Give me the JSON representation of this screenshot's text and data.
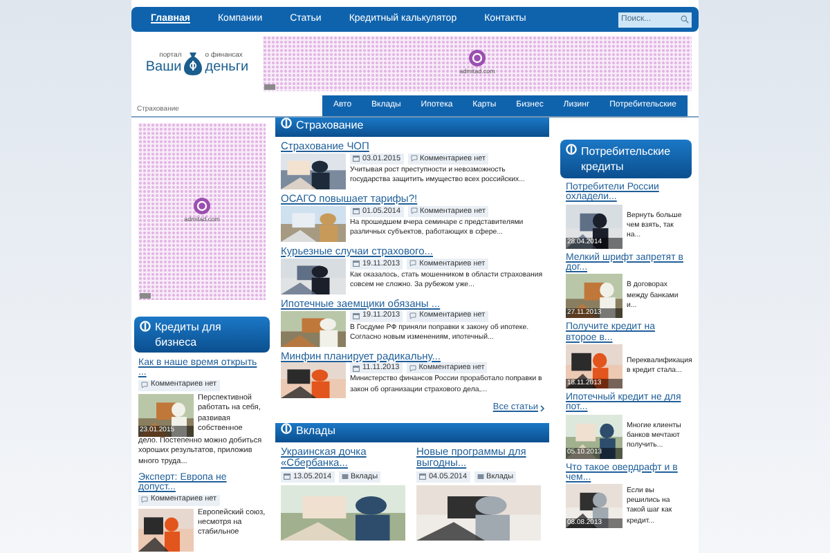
{
  "nav": {
    "items": [
      {
        "label": "Главная",
        "selected": true
      },
      {
        "label": "Компании",
        "selected": false
      },
      {
        "label": "Статьи",
        "selected": false
      },
      {
        "label": "Кредитный калькулятор",
        "selected": false
      },
      {
        "label": "Контакты",
        "selected": false
      }
    ],
    "search": {
      "placeholder": "Поиск..."
    }
  },
  "logo": {
    "top_left": "портал",
    "top_right": "о финансах",
    "left": "Ваши",
    "right": "деньги"
  },
  "banner_ad": {
    "caption": "admitad.com"
  },
  "breadcrumb": "Страхование",
  "subnav": [
    "Авто",
    "Вклады",
    "Ипотека",
    "Карты",
    "Бизнес",
    "Лизинг",
    "Потребительские"
  ],
  "sidebar_ad": {
    "caption": "admitad.com"
  },
  "business": {
    "title": "Кредиты для бизнеса",
    "items": [
      {
        "title": "Как в наше время открыть ...",
        "comments": "Комментариев нет",
        "date": "23.01.2015",
        "excerpt_side": "Перспективной работать на себя, развивая собственное",
        "excerpt_below": "дело. Постепенно можно добиться хороших результатов, приложив много труда..."
      },
      {
        "title": "Эксперт: Европа не допуст...",
        "comments": "Комментариев нет",
        "excerpt_side": "Европейский союз, несмотря на стабильное"
      }
    ]
  },
  "insurance": {
    "title": "Страхование",
    "items": [
      {
        "title": "Страхование ЧОП",
        "date": "03.01.2015",
        "comments": "Комментариев нет",
        "excerpt": "Учитывая рост преступности и невозможность государства защитить имущество всех российских..."
      },
      {
        "title": "ОСАГО повышает тарифы?!",
        "date": "01.05.2014",
        "comments": "Комментариев нет",
        "excerpt": "На прошедшем вчера семинаре с представителями различных субъектов, работающих в сфере..."
      },
      {
        "title": "Курьезные случаи страхового...",
        "date": "19.11.2013",
        "comments": "Комментариев нет",
        "excerpt": "Как оказалось, стать мошенником в области страхования совсем не сложно. За рубежом уже..."
      },
      {
        "title": "Ипотечные заемщики обязаны ...",
        "date": "19.11.2013",
        "comments": "Комментариев нет",
        "excerpt": "В Госдуме РФ приняли поправки к закону об ипотеке. Согласно новым изменениям, ипотечный..."
      },
      {
        "title": "Минфин планирует радикальну...",
        "date": "11.11.2013",
        "comments": "Комментариев нет",
        "excerpt": "Министерство финансов России проработало поправки в закон об организации страхового дела,..."
      }
    ],
    "more": "Все статьи"
  },
  "deposits": {
    "title": "Вклады",
    "items": [
      {
        "title": "Украинская дочка «Сбербанка...",
        "date": "13.05.2014",
        "category": "Вклады"
      },
      {
        "title": "Новые программы для выгодны...",
        "date": "04.05.2014",
        "category": "Вклады"
      }
    ]
  },
  "consumer": {
    "title": "Потребительские кредиты",
    "items": [
      {
        "title": "Потребители России охладели...",
        "date": "28.04.2014",
        "excerpt": "Вернуть больше чем взять, так на..."
      },
      {
        "title": "Мелкий шрифт запретят в дог...",
        "date": "27.11.2013",
        "excerpt": "В договорах между банками и..."
      },
      {
        "title": "Получите кредит на второе в...",
        "date": "18.11.2013",
        "excerpt": "Переквалификация в кредит стала..."
      },
      {
        "title": "Ипотечный кредит не для пот...",
        "date": "05.10.2013",
        "excerpt": "Многие клиенты банков мечтают получить..."
      },
      {
        "title": "Что такое овердрафт и в чем...",
        "date": "08.08.2013",
        "excerpt": "Если вы решились на такой шаг как кредит..."
      }
    ]
  }
}
